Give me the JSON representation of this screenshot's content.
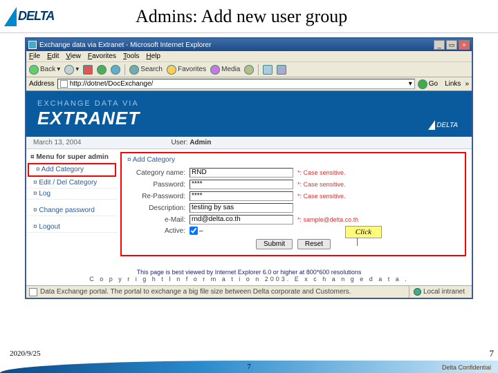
{
  "slide": {
    "title": "Admins:  Add new user group",
    "date": "2020/9/25",
    "page_num": "7",
    "confidential": "Delta Confidential"
  },
  "logo": {
    "text": "DELTA"
  },
  "ie": {
    "title": "Exchange data via Extranet - Microsoft Internet Explorer",
    "menu": {
      "file": "File",
      "edit": "Edit",
      "view": "View",
      "favorites": "Favorites",
      "tools": "Tools",
      "help": "Help"
    },
    "tools": {
      "back": "Back",
      "search": "Search",
      "favorites": "Favorites",
      "media": "Media"
    },
    "addr_label": "Address",
    "addr_value": "http://dotnet/DocExchange/",
    "go": "Go",
    "links": "Links",
    "status": "Data Exchange portal. The portal to exchange a big file size between Delta corporate and Customers.",
    "zone": "Local intranet"
  },
  "banner": {
    "sub": "EXCHANGE DATA VIA",
    "main": "EXTRANET",
    "brand": "DELTA"
  },
  "page_meta": {
    "date": "March 13, 2004",
    "user_label": "User:",
    "user": "Admin"
  },
  "sidebar": {
    "menu_title": "Menu for super admin",
    "items": [
      "Add Category",
      "Edit / Del Category",
      "Log"
    ],
    "change_pw": "Change password",
    "logout": "Logout"
  },
  "form": {
    "heading": "Add Category",
    "labels": {
      "catname": "Category name:",
      "password": "Password:",
      "repassword": "Re-Password:",
      "description": "Description:",
      "email": "e-Mail:",
      "active": "Active:"
    },
    "values": {
      "catname": "RND",
      "password": "****",
      "repassword": "****",
      "description": "testing by sas",
      "email": "rnd@delta.co.th"
    },
    "hints": {
      "case": "*: Case sensitive.",
      "sample_email": "*: sample@delta.co.th"
    },
    "buttons": {
      "submit": "Submit",
      "reset": "Reset"
    }
  },
  "callout": {
    "click": "Click"
  },
  "footer": {
    "line1": "This page is best viewed by Internet Explorer 6.0 or higher at 800*600 resolutions",
    "line2": "C o p y r i g h t    I n f o r m a t i o n   2003.  E x c h a n g e   d a t a ."
  }
}
